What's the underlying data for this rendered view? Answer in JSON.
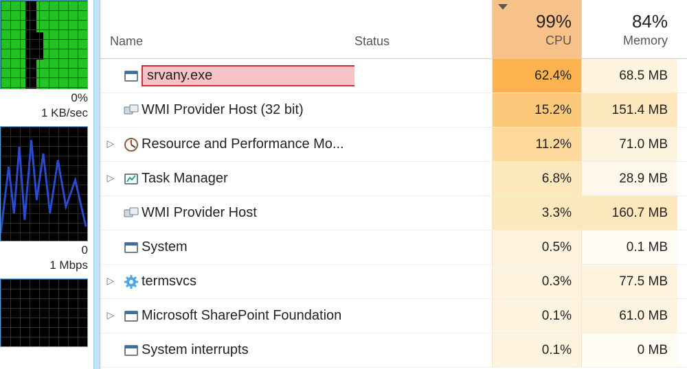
{
  "sidebar": {
    "cpu_value": "0%",
    "net_value": "1 KB/sec",
    "disk_top": "0",
    "disk_value": "1 Mbps"
  },
  "header": {
    "name_label": "Name",
    "status_label": "Status",
    "cpu_pct": "99%",
    "cpu_label": "CPU",
    "mem_pct": "84%",
    "mem_label": "Memory"
  },
  "rows": [
    {
      "expand": "",
      "icon": "app",
      "name": "srvany.exe",
      "cpu": "62.4%",
      "cpu_h": 5,
      "mem": "68.5 MB",
      "mem_h": 3,
      "highlight": true
    },
    {
      "expand": "",
      "icon": "wmi",
      "name": "WMI Provider Host (32 bit)",
      "cpu": "15.2%",
      "cpu_h": 4,
      "mem": "151.4 MB",
      "mem_h": 5
    },
    {
      "expand": "▷",
      "icon": "perf",
      "name": "Resource and Performance Mo...",
      "cpu": "11.2%",
      "cpu_h": 3,
      "mem": "71.0 MB",
      "mem_h": 3
    },
    {
      "expand": "▷",
      "icon": "chart",
      "name": "Task Manager",
      "cpu": "6.8%",
      "cpu_h": 2,
      "mem": "28.9 MB",
      "mem_h": 2
    },
    {
      "expand": "",
      "icon": "wmi",
      "name": "WMI Provider Host",
      "cpu": "3.3%",
      "cpu_h": 2,
      "mem": "160.7 MB",
      "mem_h": 5
    },
    {
      "expand": "",
      "icon": "app",
      "name": "System",
      "cpu": "0.5%",
      "cpu_h": 1,
      "mem": "0.1 MB",
      "mem_h": 1
    },
    {
      "expand": "▷",
      "icon": "gear",
      "name": "termsvcs",
      "cpu": "0.3%",
      "cpu_h": 1,
      "mem": "77.5 MB",
      "mem_h": 3
    },
    {
      "expand": "▷",
      "icon": "app",
      "name": "Microsoft SharePoint Foundation",
      "cpu": "0.1%",
      "cpu_h": 1,
      "mem": "61.0 MB",
      "mem_h": 3
    },
    {
      "expand": "",
      "icon": "app",
      "name": "System interrupts",
      "cpu": "0.1%",
      "cpu_h": 1,
      "mem": "0 MB",
      "mem_h": 1
    }
  ],
  "chart_data": [
    {
      "type": "area",
      "title": "CPU",
      "ylabel": "%",
      "ylim": [
        0,
        100
      ],
      "note": "filled near 100% with brief dips",
      "values_estimate": [
        98,
        97,
        10,
        15,
        98,
        99,
        96,
        99,
        98,
        99
      ]
    },
    {
      "type": "line",
      "title": "Network",
      "ylabel": "KB/sec",
      "note": "spiky blue line",
      "values_estimate": [
        0,
        4,
        1,
        6,
        2,
        8,
        3,
        7,
        1,
        2
      ]
    },
    {
      "type": "line",
      "title": "Disk",
      "ylabel": "Mbps",
      "note": "mostly idle",
      "values_estimate": [
        0,
        0,
        0,
        0,
        0,
        0,
        0,
        0,
        0,
        0
      ]
    }
  ]
}
